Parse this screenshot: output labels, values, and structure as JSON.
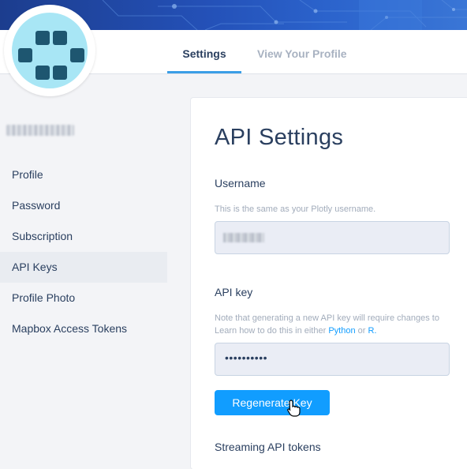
{
  "nav": {
    "tabs": [
      {
        "label": "Settings",
        "active": true
      },
      {
        "label": "View Your Profile",
        "active": false
      }
    ]
  },
  "logo": {
    "icon": "plotly-dots-logo",
    "color": "#1e5670",
    "background": "#a8e6f5"
  },
  "sidebar": {
    "items": [
      {
        "label": "Profile"
      },
      {
        "label": "Password"
      },
      {
        "label": "Subscription"
      },
      {
        "label": "API Keys",
        "active": true
      },
      {
        "label": "Profile Photo"
      },
      {
        "label": "Mapbox Access Tokens"
      }
    ]
  },
  "main": {
    "title": "API Settings",
    "username": {
      "label": "Username",
      "help": "This is the same as your Plotly username."
    },
    "api_key": {
      "label": "API key",
      "help_line1": "Note that generating a new API key will require changes to",
      "help_line2_prefix": "Learn how to do this in either",
      "link_python": "Python",
      "help_or": "or",
      "link_r": "R.",
      "value": "••••••••••",
      "regenerate_label": "Regenerate Key"
    },
    "streaming": {
      "label": "Streaming API tokens"
    }
  },
  "colors": {
    "accent": "#119dff",
    "tab_indicator": "#3b9ee6",
    "text": "#2a3f5f"
  }
}
